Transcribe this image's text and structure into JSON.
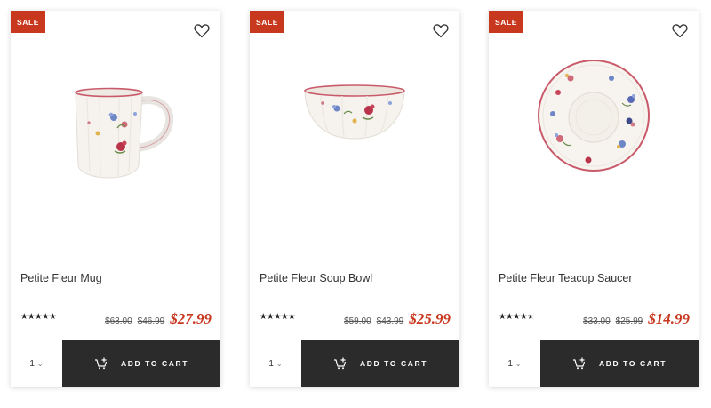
{
  "products": [
    {
      "badge": "SALE",
      "name": "Petite Fleur Mug",
      "rating": 5,
      "rating_display": "★★★★★",
      "prices": {
        "original": "$63.00",
        "previous": "$46.99",
        "sale": "$27.99"
      },
      "quantity": "1",
      "cart_label": "ADD TO CART",
      "wishlist_icon": "heart-outline-icon",
      "image": "mug"
    },
    {
      "badge": "SALE",
      "name": "Petite Fleur Soup Bowl",
      "rating": 5,
      "rating_display": "★★★★★",
      "prices": {
        "original": "$59.00",
        "previous": "$43.99",
        "sale": "$25.99"
      },
      "quantity": "1",
      "cart_label": "ADD TO CART",
      "wishlist_icon": "heart-outline-icon",
      "image": "bowl"
    },
    {
      "badge": "SALE",
      "name": "Petite Fleur Teacup Saucer",
      "rating": 4.5,
      "rating_display": "★★★★",
      "prices": {
        "original": "$33.00",
        "previous": "$25.99",
        "sale": "$14.99"
      },
      "quantity": "1",
      "cart_label": "ADD TO CART",
      "wishlist_icon": "heart-outline-icon",
      "image": "saucer"
    }
  ],
  "colors": {
    "sale_red": "#c8381e",
    "button_dark": "#2b2b2b",
    "rim_pink": "#c95a6a"
  }
}
